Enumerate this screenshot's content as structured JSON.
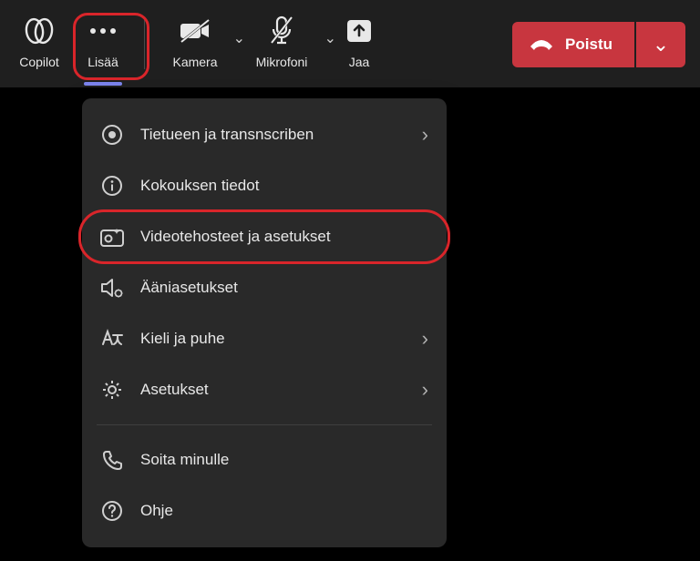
{
  "toolbar": {
    "copilot": "Copilot",
    "more": "Lisää",
    "camera": "Kamera",
    "mic": "Mikrofoni",
    "share": "Jaa",
    "leave": "Poistu"
  },
  "menu": {
    "record": "Tietueen ja transnscriben",
    "info": "Kokouksen tiedot",
    "video_effects": "Videotehosteet ja asetukset",
    "audio": "Ääniasetukset",
    "language": "Kieli ja puhe",
    "settings": "Asetukset",
    "call_me": "Soita minulle",
    "help": "Ohje"
  },
  "icons": {
    "copilot": "copilot-icon",
    "more": "more-icon",
    "camera": "camera-off-icon",
    "mic": "mic-off-icon",
    "share": "share-icon",
    "hangup": "hangup-icon",
    "chevron_down": "chevron-down-icon",
    "chevron_right": "chevron-right-icon",
    "record": "record-icon",
    "info_circle": "info-icon",
    "video_effects": "video-effects-icon",
    "speaker": "speaker-settings-icon",
    "language": "language-icon",
    "gear": "gear-icon",
    "phone": "phone-icon",
    "help": "help-icon"
  }
}
